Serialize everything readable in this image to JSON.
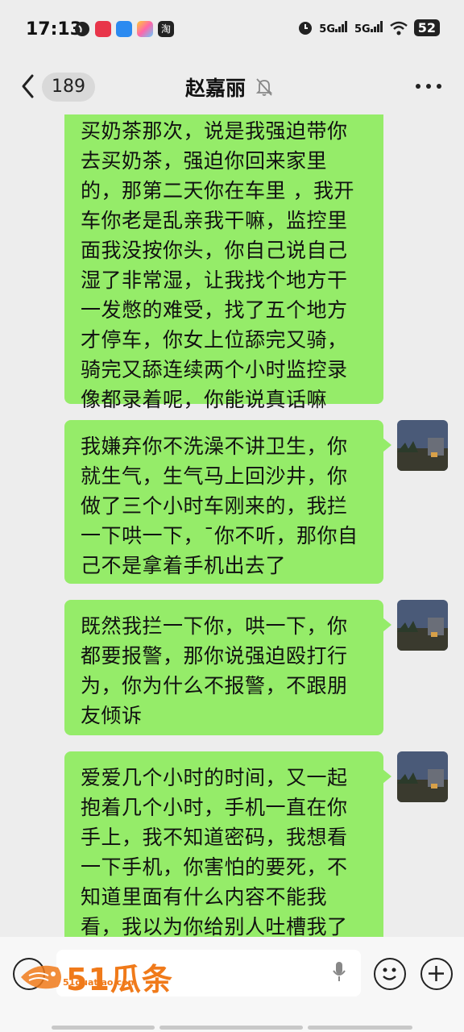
{
  "status_bar": {
    "time": "17:13",
    "signal_1": "5G",
    "signal_2": "5G",
    "battery": "52"
  },
  "header": {
    "unread_count": "189",
    "contact_name": "赵嘉丽",
    "icons": [
      "back-chevron-icon",
      "mute-bell-icon",
      "more-icon"
    ]
  },
  "messages": [
    {
      "sender": "me",
      "text": "买奶茶那次，说是我强迫带你去买奶茶，强迫你回来家里的，那第二天你在车里 ，我开车你老是乱亲我干嘛，监控里面我没按你头，你自己说自己湿了非常湿，让我找个地方干一发憋的难受，找了五个地方才停车，你女上位舔完又骑，骑完又舔连续两个小时监控录像都录着呢，你能说真话嘛"
    },
    {
      "sender": "me",
      "text": "我嫌弃你不洗澡不讲卫生，你就生气，生气马上回沙井，你做了三个小时车刚来的，我拦一下哄一下，¯你不听，那你自己不是拿着手机出去了"
    },
    {
      "sender": "me",
      "text": "既然我拦一下你，哄一下，你都要报警，那你说强迫殴打行为，你为什么不报警，不跟朋友倾诉"
    },
    {
      "sender": "me",
      "text": "爱爱几个小时的时间，又一起抱着几个小时，手机一直在你手上，我不知道密码，我想看一下手机，你害怕的要死，不知道里面有什么内容不能我看，我以为你给别人吐槽我了"
    }
  ],
  "watermark": {
    "main": "51瓜条",
    "sub": "51guatiao.com"
  },
  "colors": {
    "bubble_green": "#95ec69",
    "background": "#ededed",
    "watermark_orange": "#f07a1a"
  }
}
